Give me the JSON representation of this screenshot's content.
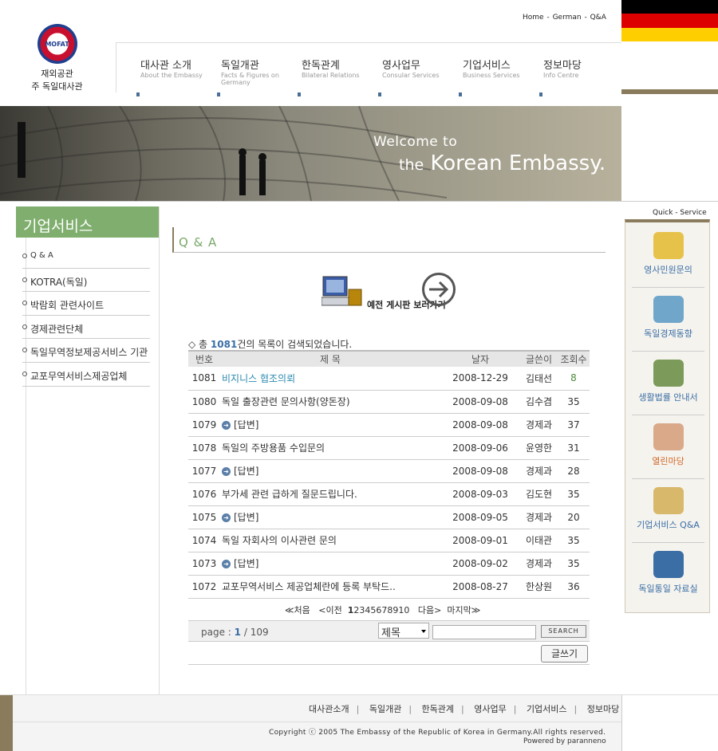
{
  "top_links": [
    "Home",
    "German",
    "Q&A"
  ],
  "logo": {
    "badge": "MOFAT",
    "line1": "재외공관",
    "line2": "주 독일대사관"
  },
  "nav": [
    {
      "ko": "대사관 소개",
      "en": "About the Embassy"
    },
    {
      "ko": "독일개관",
      "en": "Facts & Figures on Germany"
    },
    {
      "ko": "한독관계",
      "en": "Bilateral Relations"
    },
    {
      "ko": "영사업무",
      "en": "Consular Services"
    },
    {
      "ko": "기업서비스",
      "en": "Business Services"
    },
    {
      "ko": "정보마당",
      "en": "Info Centre"
    }
  ],
  "banner": {
    "line1": "Welcome to",
    "the": "the",
    "line2": "Korean Embassy."
  },
  "sidebar": {
    "title": "기업서비스",
    "items": [
      "Q & A",
      "KOTRA(독일)",
      "박람회 관련사이트",
      "경제관련단체",
      "독일무역정보제공서비스 기관",
      "교포무역서비스제공업체"
    ]
  },
  "main": {
    "title": "Q & A",
    "old_board": "예전 게시판 보러가기",
    "summary_prefix": "총 ",
    "summary_count": "1081",
    "summary_suffix": "건의 목록이 검색되었습니다.",
    "headers": [
      "번호",
      "제 목",
      "날자",
      "글쓴이",
      "조회수"
    ],
    "rows": [
      {
        "num": "1081",
        "subject": "비지니스 협조의뢰",
        "date": "2008-12-29",
        "writer": "김태선",
        "hits": "8",
        "reply": false,
        "highlight": true
      },
      {
        "num": "1080",
        "subject": "독일 출장관련 문의사항(양돈장)",
        "date": "2008-09-08",
        "writer": "김수겸",
        "hits": "35",
        "reply": false
      },
      {
        "num": "1079",
        "subject": "[답변]",
        "date": "2008-09-08",
        "writer": "경제과",
        "hits": "37",
        "reply": true
      },
      {
        "num": "1078",
        "subject": "독일의 주방용품 수입문의",
        "date": "2008-09-06",
        "writer": "윤영한",
        "hits": "31",
        "reply": false
      },
      {
        "num": "1077",
        "subject": "[답변]",
        "date": "2008-09-08",
        "writer": "경제과",
        "hits": "28",
        "reply": true
      },
      {
        "num": "1076",
        "subject": "부가세 관련 급하게 질문드립니다.",
        "date": "2008-09-03",
        "writer": "김도현",
        "hits": "35",
        "reply": false
      },
      {
        "num": "1075",
        "subject": "[답변]",
        "date": "2008-09-05",
        "writer": "경제과",
        "hits": "20",
        "reply": true
      },
      {
        "num": "1074",
        "subject": "독일 자회사의 이사관련 문의",
        "date": "2008-09-01",
        "writer": "이태관",
        "hits": "35",
        "reply": false
      },
      {
        "num": "1073",
        "subject": "[답변]",
        "date": "2008-09-02",
        "writer": "경제과",
        "hits": "35",
        "reply": true
      },
      {
        "num": "1072",
        "subject": "교포무역서비스 제공업체란에 등록 부탁드..",
        "date": "2008-08-27",
        "writer": "한상원",
        "hits": "36",
        "reply": false
      }
    ],
    "paging": {
      "first": "≪처음",
      "prev": "<이전",
      "pages": [
        "1",
        "2",
        "3",
        "4",
        "5",
        "6",
        "7",
        "8",
        "9",
        "10"
      ],
      "next": "다음>",
      "last": "마지막≫"
    },
    "page_info_prefix": "page : ",
    "page_current": "1",
    "page_total": " / 109",
    "search_select": "제목",
    "search_button": "SEARCH",
    "write_button": "글쓰기"
  },
  "quick": {
    "title": "Quick - Service",
    "items": [
      {
        "label": "영사민원문의",
        "icon": "notepad-icon",
        "color": "#e7c24a"
      },
      {
        "label": "독일경제동향",
        "icon": "chart-icon",
        "color": "#6fa6c9"
      },
      {
        "label": "생활법률 안내서",
        "icon": "book-icon",
        "color": "#7c9a5a"
      },
      {
        "label": "열린마당",
        "icon": "people-icon",
        "color": "#d9a98a"
      },
      {
        "label": "기업서비스 Q&A",
        "icon": "qa-icon",
        "color": "#d8b86a"
      },
      {
        "label": "독일통일 자료실",
        "icon": "map-icon",
        "color": "#3a6ea5"
      }
    ]
  },
  "footer": {
    "links": [
      "대사관소개",
      "독일개관",
      "한독관계",
      "영사업무",
      "기업서비스",
      "정보마당"
    ],
    "copyright": "Copyright ⓒ 2005 The Embassy of the Republic of Korea in Germany.All rights reserved.",
    "powered": "Powered by paranneno"
  }
}
